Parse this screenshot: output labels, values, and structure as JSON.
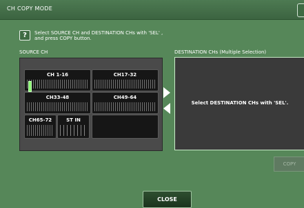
{
  "window": {
    "title": "CH COPY MODE"
  },
  "instructions": {
    "line1": "Select SOURCE CH and DESTINATION CHs with 'SEL' ,",
    "line2": "and press COPY button."
  },
  "source": {
    "label": "SOURCE CH",
    "groups": [
      {
        "name": "CH 1-16",
        "selected": true
      },
      {
        "name": "CH17-32",
        "selected": false
      },
      {
        "name": "CH33-48",
        "selected": false
      },
      {
        "name": "CH49-64",
        "selected": false
      },
      {
        "name": "CH65-72",
        "selected": false
      },
      {
        "name": "ST IN",
        "selected": false
      }
    ]
  },
  "destination": {
    "label": "DESTINATION CHs (Multiple Selection)",
    "message": "Select DESTINATION CHs with 'SEL'."
  },
  "buttons": {
    "copy": "COPY",
    "close": "CLOSE"
  },
  "colors": {
    "background": "#568759",
    "panel": "#4a4a4a",
    "selected_channel": "#8bff70"
  }
}
